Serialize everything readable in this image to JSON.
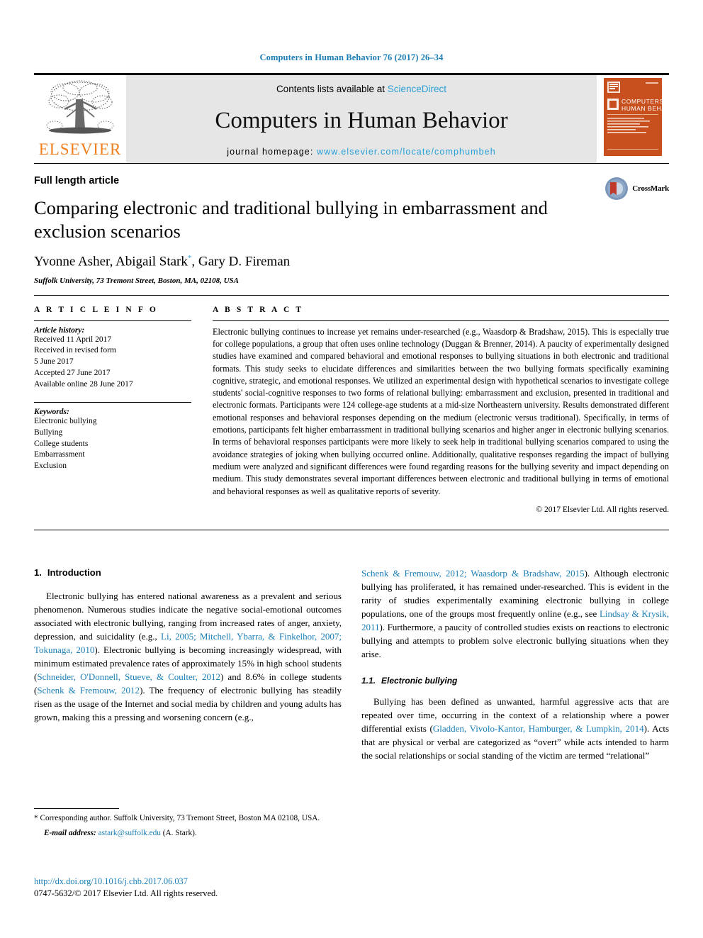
{
  "running_head": "Computers in Human Behavior 76 (2017) 26–34",
  "masthead": {
    "publisher": "ELSEVIER",
    "contents_prefix": "Contents lists available at ",
    "contents_link": "ScienceDirect",
    "journal_title": "Computers in Human Behavior",
    "homepage_prefix": "journal homepage: ",
    "homepage_url": "www.elsevier.com/locate/comphumbeh",
    "cover_title_line1": "COMPUTERS IN",
    "cover_title_line2": "HUMAN BEHAVIOR",
    "cover_color": "#c8501e"
  },
  "title_block": {
    "article_type": "Full length article",
    "title": "Comparing electronic and traditional bullying in embarrassment and exclusion scenarios",
    "authors": "Yvonne Asher, Abigail Stark",
    "authors_suffix": ", Gary D. Fireman",
    "corresponding_marker": "*",
    "affiliation": "Suffolk University, 73 Tremont Street, Boston, MA, 02108, USA",
    "crossmark_label": "CrossMark"
  },
  "article_info": {
    "heading": "A R T I C L E   I N F O",
    "history_label": "Article history:",
    "history": [
      "Received 11 April 2017",
      "Received in revised form",
      "5 June 2017",
      "Accepted 27 June 2017",
      "Available online 28 June 2017"
    ],
    "keywords_label": "Keywords:",
    "keywords": [
      "Electronic bullying",
      "Bullying",
      "College students",
      "Embarrassment",
      "Exclusion"
    ]
  },
  "abstract": {
    "heading": "A B S T R A C T",
    "text": "Electronic bullying continues to increase yet remains under-researched (e.g., Waasdorp & Bradshaw, 2015). This is especially true for college populations, a group that often uses online technology (Duggan & Brenner, 2014). A paucity of experimentally designed studies have examined and compared behavioral and emotional responses to bullying situations in both electronic and traditional formats. This study seeks to elucidate differences and similarities between the two bullying formats specifically examining cognitive, strategic, and emotional responses. We utilized an experimental design with hypothetical scenarios to investigate college students' social-cognitive responses to two forms of relational bullying: embarrassment and exclusion, presented in traditional and electronic formats. Participants were 124 college-age students at a mid-size Northeastern university. Results demonstrated different emotional responses and behavioral responses depending on the medium (electronic versus traditional). Specifically, in terms of emotions, participants felt higher embarrassment in traditional bullying scenarios and higher anger in electronic bullying scenarios. In terms of behavioral responses participants were more likely to seek help in traditional bullying scenarios compared to using the avoidance strategies of joking when bullying occurred online. Additionally, qualitative responses regarding the impact of bullying medium were analyzed and significant differences were found regarding reasons for the bullying severity and impact depending on medium. This study demonstrates several important differences between electronic and traditional bullying in terms of emotional and behavioral responses as well as qualitative reports of severity.",
    "copyright": "© 2017 Elsevier Ltd. All rights reserved."
  },
  "body": {
    "section1_num": "1.",
    "section1_title": "Introduction",
    "para1_a": "Electronic bullying has entered national awareness as a prevalent and serious phenomenon. Numerous studies indicate the negative social-emotional outcomes associated with electronic bullying, ranging from increased rates of anger, anxiety, depression, and suicidality (e.g., ",
    "para1_ref1": "Li, 2005; Mitchell, Ybarra, & Finkelhor, 2007; Tokunaga, 2010",
    "para1_b": "). Electronic bullying is becoming increasingly widespread, with minimum estimated prevalence rates of approximately 15% in high school students (",
    "para1_ref2": "Schneider, O'Donnell, Stueve, & Coulter, 2012",
    "para1_c": ") and 8.6% in college students (",
    "para1_ref3": "Schenk & Fremouw, 2012",
    "para1_d": "). The frequency of electronic bullying has steadily risen as the usage of the Internet and social media by children and young adults has grown, making this a pressing and worsening concern (e.g., ",
    "para1_ref4": "Schenk & Fremouw, 2012; Waasdorp & Bradshaw, 2015",
    "para1_e": "). Although electronic bullying has proliferated, it has remained under-researched. This is evident in the rarity of studies experimentally examining electronic bullying in college populations, one of the groups most frequently online (e.g., see ",
    "para1_ref5": "Lindsay & Krysik, 2011",
    "para1_f": "). Furthermore, a paucity of controlled studies exists on reactions to electronic bullying and attempts to problem solve electronic bullying situations when they arise.",
    "section11_num": "1.1.",
    "section11_title": "Electronic bullying",
    "para2_a": "Bullying has been defined as unwanted, harmful aggressive acts that are repeated over time, occurring in the context of a relationship where a power differential exists (",
    "para2_ref1": "Gladden, Vivolo-Kantor, Hamburger, & Lumpkin, 2014",
    "para2_b": "). Acts that are physical or verbal are categorized as “overt” while acts intended to harm the social relationships or social standing of the victim are termed “relational”"
  },
  "footer": {
    "corresponding_marker": "*",
    "corresponding_text": " Corresponding author. Suffolk University, 73 Tremont Street, Boston MA 02108, USA.",
    "email_label": "E-mail address:",
    "email": "astark@suffolk.edu",
    "email_attrib": "(A. Stark).",
    "doi": "http://dx.doi.org/10.1016/j.chb.2017.06.037",
    "issn_line": "0747-5632/© 2017 Elsevier Ltd. All rights reserved."
  },
  "colors": {
    "link": "#1a7eb5",
    "link_light": "#2a9fd6",
    "elsevier_orange": "#f08020",
    "masthead_bg": "#e6e6e6"
  }
}
